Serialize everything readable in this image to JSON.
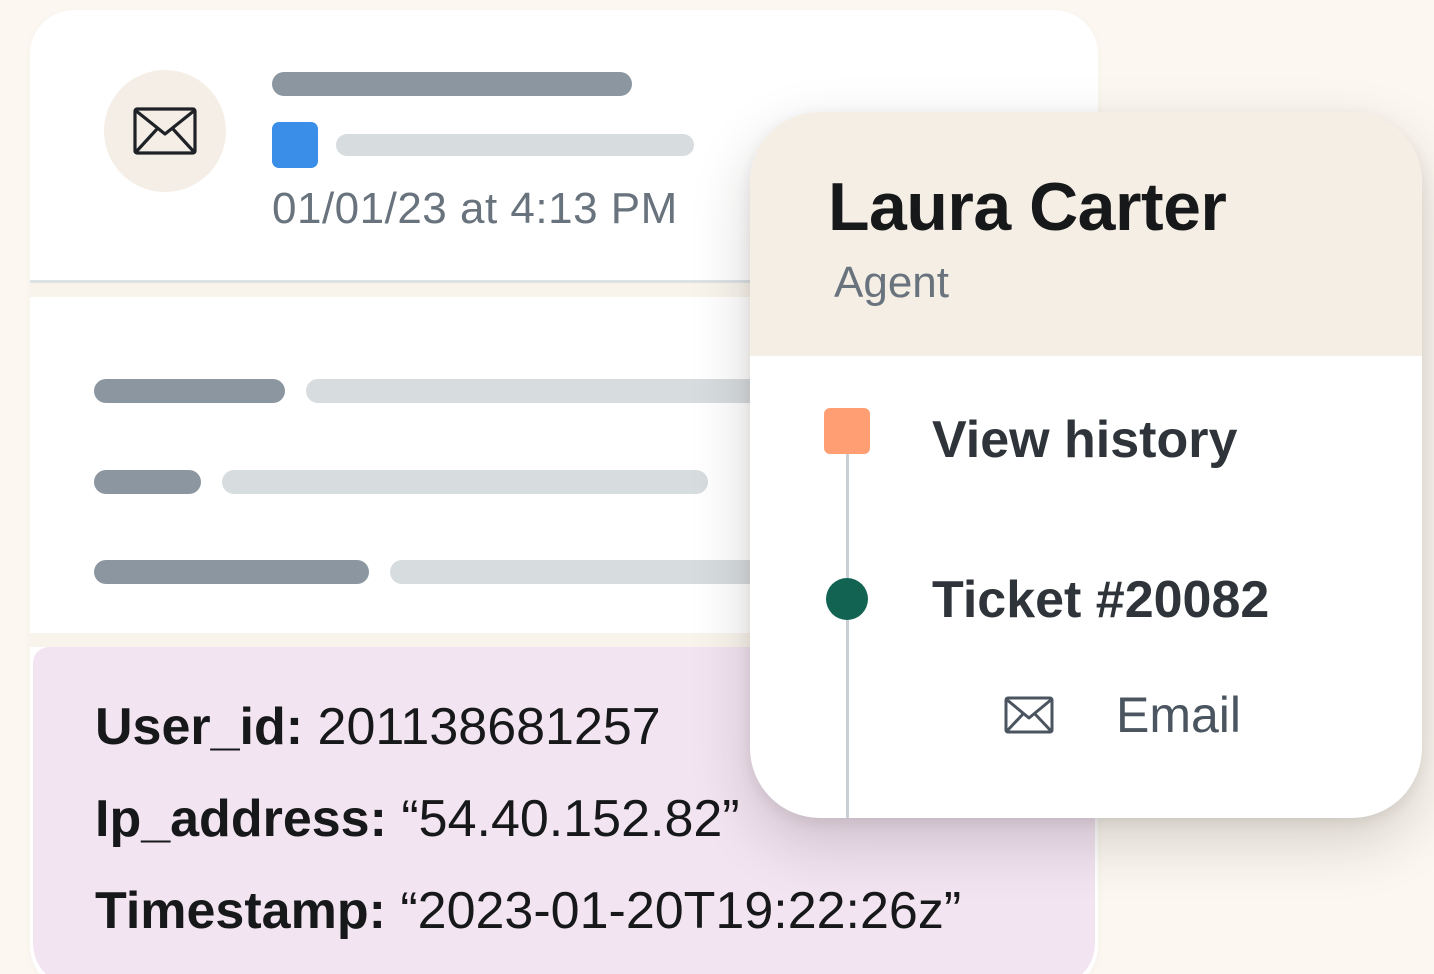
{
  "email_card": {
    "date": "01/01/23 at 4:13 PM",
    "metadata": [
      {
        "key": "User_id:",
        "value": "201138681257"
      },
      {
        "key": "Ip_address:",
        "value": "“54.40.152.82”"
      },
      {
        "key": "Timestamp:",
        "value": "“2023-01-20T19:22:26z”"
      }
    ]
  },
  "agent_card": {
    "name": "Laura Carter",
    "role": "Agent",
    "timeline": {
      "view_history": "View history",
      "ticket": "Ticket #20082",
      "channel": "Email",
      "channel_icon": "envelope-icon"
    }
  },
  "colors": {
    "background": "#FCF8F1",
    "blue_status": "#3A8EE8",
    "orange_marker": "#FF9E73",
    "teal_marker": "#126352",
    "metadata_panel": "#F2E4F1",
    "agent_header": "#F4EEE5"
  },
  "icons": {
    "avatar": "envelope-icon",
    "channel": "envelope-icon"
  }
}
